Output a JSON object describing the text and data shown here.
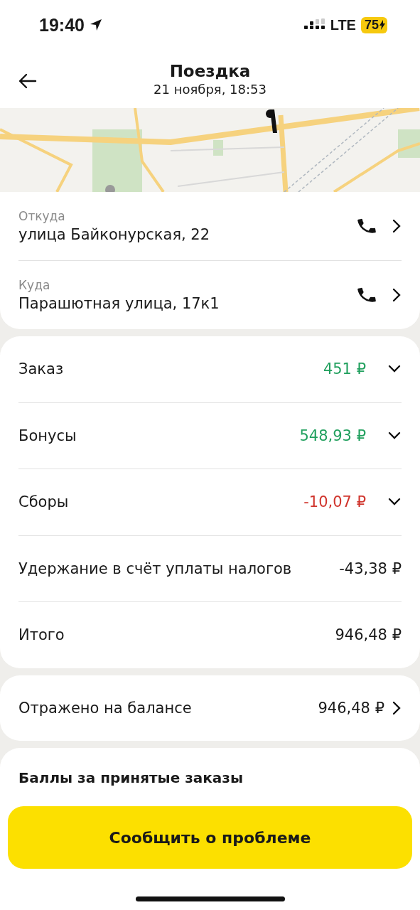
{
  "status_bar": {
    "time": "19:40",
    "network": "LTE",
    "battery": "75"
  },
  "header": {
    "title": "Поездка",
    "subtitle": "21 ноября, 18:53"
  },
  "route": [
    {
      "label": "Откуда",
      "address": "улица Байконурская, 22"
    },
    {
      "label": "Куда",
      "address": "Парашютная улица, 17к1"
    }
  ],
  "payments": [
    {
      "label": "Заказ",
      "amount": "451 ₽",
      "color": "#21a05e",
      "expandable": true
    },
    {
      "label": "Бонусы",
      "amount": "548,93 ₽",
      "color": "#21a05e",
      "expandable": true
    },
    {
      "label": "Сборы",
      "amount": "-10,07 ₽",
      "color": "#d0342c",
      "expandable": true
    },
    {
      "label": "Удержание в счёт уплаты налогов",
      "amount": "-43,38 ₽",
      "color": "#1a1a1a",
      "expandable": false
    },
    {
      "label": "Итого",
      "amount": "946,48 ₽",
      "color": "#1a1a1a",
      "expandable": false
    }
  ],
  "balance": {
    "label": "Отражено на балансе",
    "amount": "946,48 ₽"
  },
  "points": {
    "title": "Баллы за принятые заказы"
  },
  "action_button": "Сообщить о проблеме"
}
